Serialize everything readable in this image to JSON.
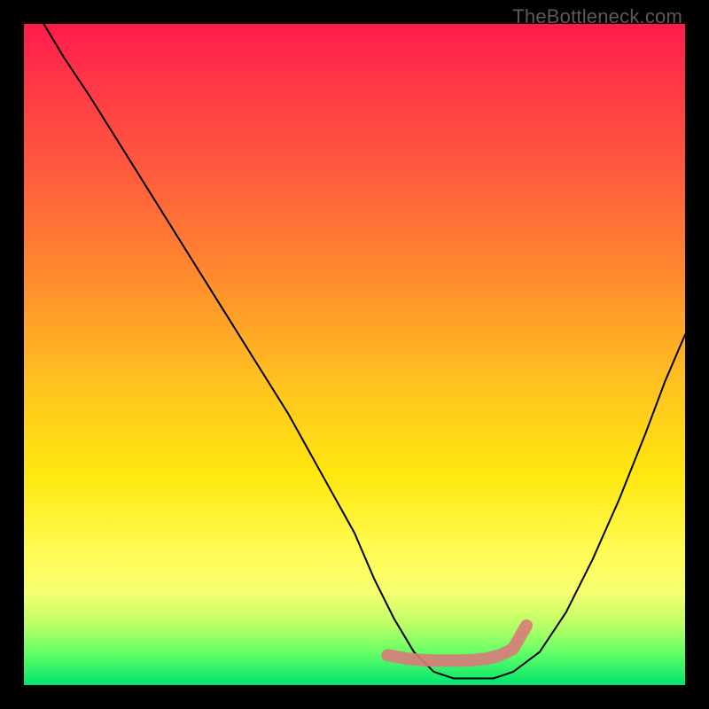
{
  "attribution": "TheBottleneck.com",
  "chart_data": {
    "type": "line",
    "title": "",
    "xlabel": "",
    "ylabel": "",
    "xlim": [
      0,
      100
    ],
    "ylim": [
      0,
      100
    ],
    "series": [
      {
        "name": "bottleneck-curve",
        "x": [
          3,
          6,
          10,
          15,
          20,
          25,
          30,
          35,
          40,
          45,
          50,
          53,
          56,
          59,
          62,
          65,
          68,
          71,
          74,
          78,
          82,
          86,
          90,
          94,
          97,
          100
        ],
        "values": [
          100,
          95,
          89,
          81,
          73,
          65,
          57,
          49,
          41,
          32,
          23,
          16,
          10,
          5,
          2,
          1,
          1,
          1,
          2,
          5,
          11,
          19,
          28,
          38,
          46,
          53
        ]
      },
      {
        "name": "anomaly-marker",
        "x": [
          55,
          58,
          60,
          62,
          64,
          66,
          68,
          70,
          72,
          74,
          76
        ],
        "values": [
          4.5,
          4,
          3.8,
          3.7,
          3.7,
          3.7,
          3.8,
          4,
          4.5,
          5.5,
          9
        ]
      }
    ],
    "colors": {
      "curve": "#000000",
      "marker": "#d97a7a"
    }
  }
}
